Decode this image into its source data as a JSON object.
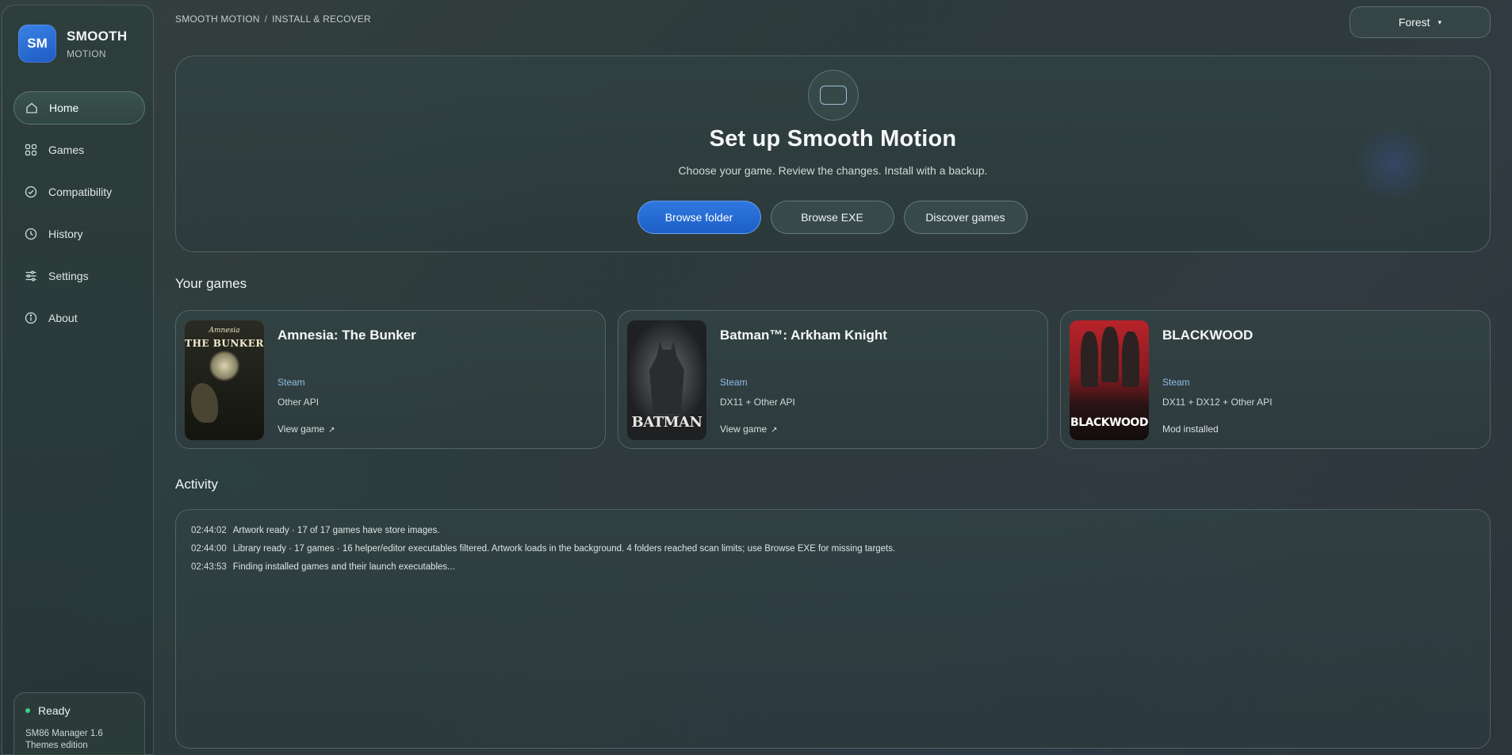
{
  "brand": {
    "logo": "SM",
    "title": "SMOOTH",
    "subtitle": "MOTION"
  },
  "nav": [
    {
      "label": "Home",
      "icon": "home-icon",
      "active": true
    },
    {
      "label": "Games",
      "icon": "grid-icon"
    },
    {
      "label": "Compatibility",
      "icon": "check-circle-icon"
    },
    {
      "label": "History",
      "icon": "clock-icon"
    },
    {
      "label": "Settings",
      "icon": "sliders-icon"
    },
    {
      "label": "About",
      "icon": "info-icon"
    }
  ],
  "status": {
    "label": "Ready",
    "version": "SM86 Manager 1.6",
    "edition": "Themes edition",
    "color": "#3ecf8e"
  },
  "breadcrumb": {
    "root": "SMOOTH MOTION",
    "separator": "/",
    "current": "INSTALL & RECOVER"
  },
  "theme": {
    "selected": "Forest",
    "caret": "▾"
  },
  "hero": {
    "icon": "window-icon",
    "title": "Set up Smooth Motion",
    "subtitle": "Choose your game. Review the changes. Install with a backup.",
    "actions": {
      "browse_folder": "Browse folder",
      "browse_exe": "Browse EXE",
      "discover": "Discover games"
    }
  },
  "games_section": {
    "title": "Your games"
  },
  "games": [
    {
      "name": "Amnesia: The Bunker",
      "cover_title_line1": "Amnesia",
      "cover_title_line2": "THE BUNKER",
      "store": "Steam",
      "api": "Other API",
      "action": "View game",
      "action_icon": "↗"
    },
    {
      "name": "Batman™: Arkham Knight",
      "cover_title": "BATMAN",
      "store": "Steam",
      "api": "DX11 + Other API",
      "action": "View game",
      "action_icon": "↗"
    },
    {
      "name": "BLACKWOOD",
      "cover_title": "BLACKWOOD",
      "store": "Steam",
      "api": "DX11 + DX12 + Other API",
      "state": "Mod installed"
    }
  ],
  "activity_section": {
    "title": "Activity"
  },
  "activity": [
    {
      "time": "02:44:02",
      "message": "Artwork ready · 17 of 17 games have store images."
    },
    {
      "time": "02:44:00",
      "message": "Library ready · 17 games · 16 helper/editor executables filtered. Artwork loads in the background. 4 folders reached scan limits; use Browse EXE for missing targets."
    },
    {
      "time": "02:43:53",
      "message": "Finding installed games and their launch executables..."
    }
  ],
  "colors": {
    "accent": "#2f78e0",
    "store_link": "#8fbde8",
    "ready": "#3ecf8e"
  }
}
